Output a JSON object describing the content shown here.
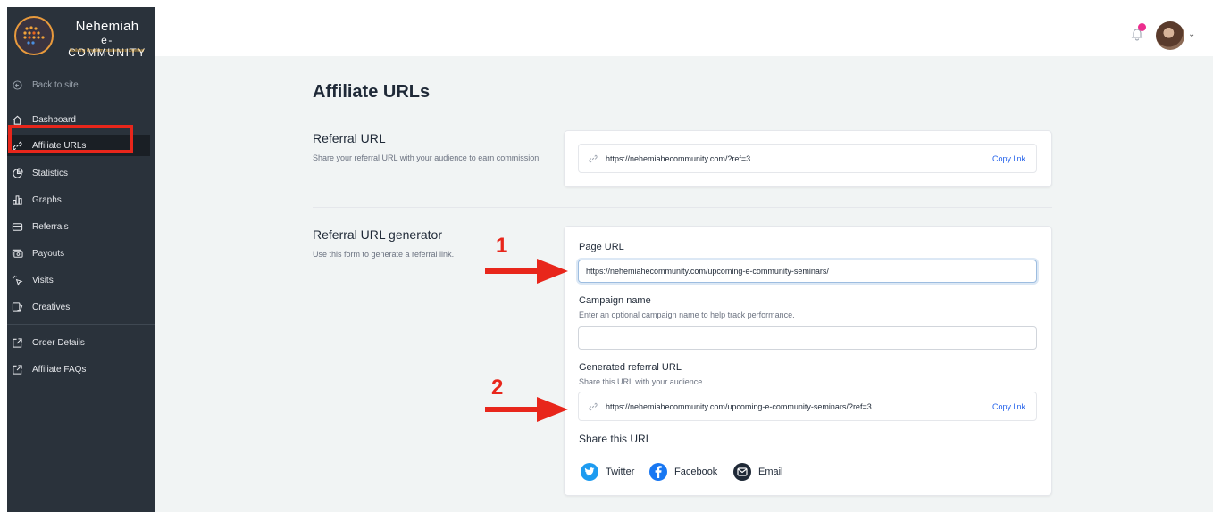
{
  "brand": {
    "name_line1": "Nehemiah",
    "name_line2": "e-COMMUNITY",
    "tagline": "building kingdom businesses together"
  },
  "sidebar": {
    "back_label": "Back to site",
    "items": [
      {
        "label": "Dashboard",
        "icon": "home-icon"
      },
      {
        "label": "Affiliate URLs",
        "icon": "link-icon",
        "active": true
      },
      {
        "label": "Statistics",
        "icon": "pie-chart-icon"
      },
      {
        "label": "Graphs",
        "icon": "bar-chart-icon"
      },
      {
        "label": "Referrals",
        "icon": "credit-card-icon"
      },
      {
        "label": "Payouts",
        "icon": "cash-icon"
      },
      {
        "label": "Visits",
        "icon": "cursor-click-icon"
      },
      {
        "label": "Creatives",
        "icon": "image-icon"
      }
    ],
    "external_items": [
      {
        "label": "Order Details",
        "icon": "external-link-icon"
      },
      {
        "label": "Affiliate FAQs",
        "icon": "external-link-icon"
      }
    ]
  },
  "page": {
    "title": "Affiliate URLs"
  },
  "referral_url": {
    "title": "Referral URL",
    "description": "Share your referral URL with your audience to earn commission.",
    "url": "https://nehemiahecommunity.com/?ref=3",
    "copy_label": "Copy link"
  },
  "generator": {
    "title": "Referral URL generator",
    "description": "Use this form to generate a referral link.",
    "page_url_label": "Page URL",
    "page_url_value": "https://nehemiahecommunity.com/upcoming-e-community-seminars/",
    "campaign_label": "Campaign name",
    "campaign_help": "Enter an optional campaign name to help track performance.",
    "campaign_value": "",
    "generated_label": "Generated referral URL",
    "generated_help": "Share this URL with your audience.",
    "generated_url": "https://nehemiahecommunity.com/upcoming-e-community-seminars/?ref=3",
    "copy_label": "Copy link",
    "share_title": "Share this URL",
    "share": [
      {
        "label": "Twitter",
        "icon": "twitter-icon",
        "color": "#1d9bf0"
      },
      {
        "label": "Facebook",
        "icon": "facebook-icon",
        "color": "#1877f2"
      },
      {
        "label": "Email",
        "icon": "email-icon",
        "color": "#1f2937"
      }
    ]
  },
  "annotations": {
    "marker_1": "1",
    "marker_2": "2",
    "color": "#e8261b"
  }
}
